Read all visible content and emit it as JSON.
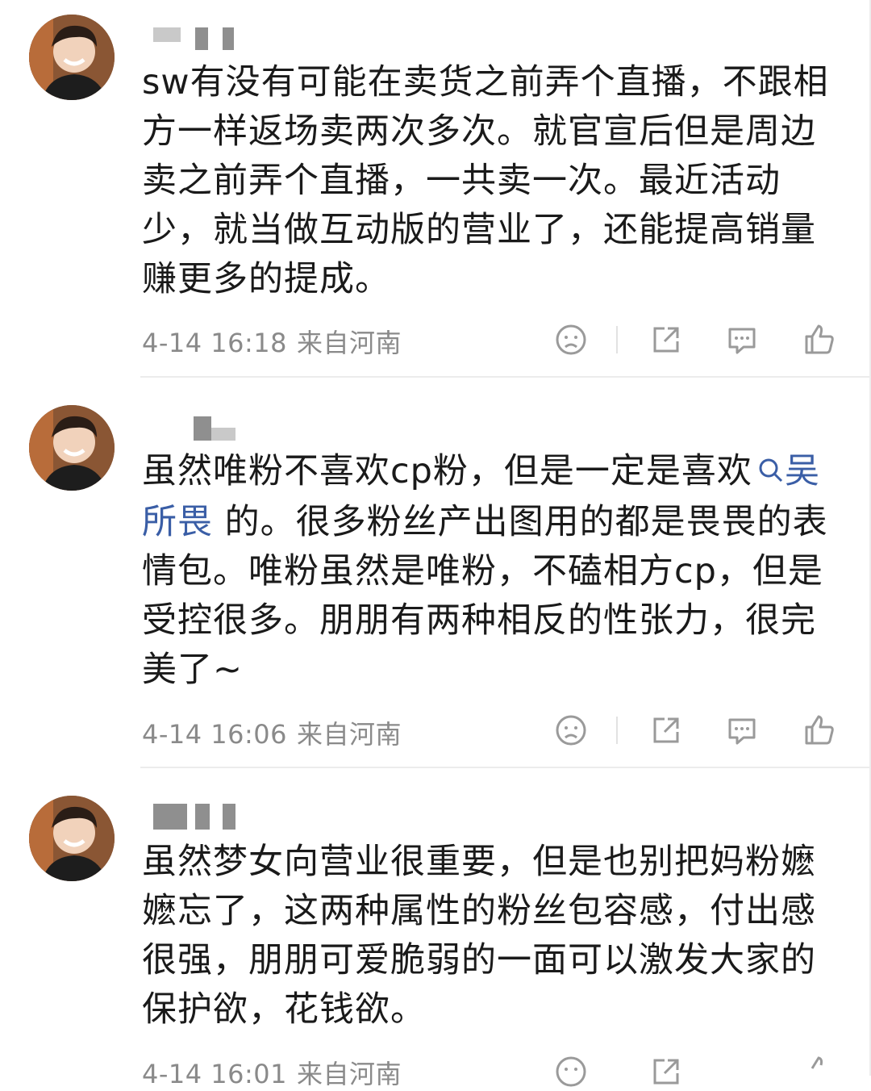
{
  "posts": [
    {
      "content": "sw有没有可能在卖货之前弄个直播，不跟相方一样返场卖两次多次。就官宣后但是周边卖之前弄个直播，一共卖一次。最近活动少，就当做互动版的营业了，还能提高销量赚更多的提成。",
      "time": "4-14 16:18",
      "location": "来自河南"
    },
    {
      "content_before": "虽然唯粉不喜欢cp粉，但是一定是喜欢",
      "topic": "吴所畏",
      "content_after": " 的。很多粉丝产出图用的都是畏畏的表情包。唯粉虽然是唯粉，不磕相方cp，但是受控很多。朋朋有两种相反的性张力，很完美了~",
      "time": "4-14 16:06",
      "location": "来自河南"
    },
    {
      "content": "虽然梦女向营业很重要，但是也别把妈粉嬷嬷忘了，这两种属性的粉丝包容感，付出感很强，朋朋可爱脆弱的一面可以激发大家的保护欲，花钱欲。",
      "time": "4-14 16:01",
      "location": "来自河南"
    }
  ],
  "icons": {
    "dislike": "sad-face-icon",
    "share": "share-icon",
    "comment": "comment-icon",
    "like": "thumbs-up-icon",
    "topic_search": "search-icon"
  },
  "colors": {
    "text": "#1a1a1a",
    "meta": "#8a8a8a",
    "topic_link": "#3a5ea6",
    "icon": "#9a9a9a"
  }
}
